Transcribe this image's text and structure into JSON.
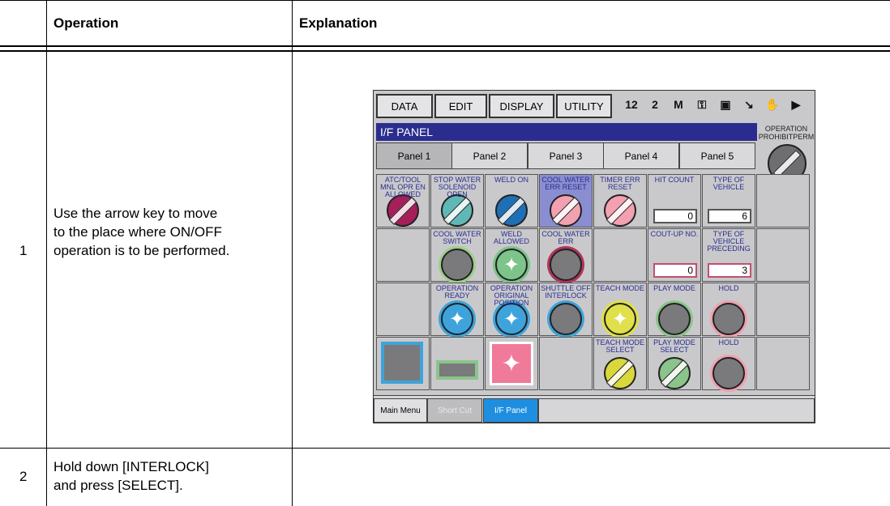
{
  "table": {
    "header_operation": "Operation",
    "header_explanation": "Explanation",
    "rows": [
      {
        "num": "1",
        "operation": "Use the arrow key to move to the place where ON/OFF operation is to be performed."
      },
      {
        "num": "2",
        "operation": "Hold down [INTERLOCK] and press [SELECT]."
      }
    ]
  },
  "screen": {
    "menu": [
      "DATA",
      "EDIT",
      "DISPLAY",
      "UTILITY"
    ],
    "toolbar_icons": [
      "12",
      "2",
      "M",
      "⚿",
      "▣",
      "↘",
      "✋",
      "▶"
    ],
    "toolbar_icon_names": [
      "job-number-icon",
      "step-number-icon",
      "monitor-icon",
      "key-icon",
      "file-icon",
      "arrow-icon",
      "hand-icon",
      "play-icon"
    ],
    "panel_title": "I/F PANEL",
    "corner_knob_label": "OPERATION PROHIBITPERM",
    "tabs": [
      "Panel 1",
      "Panel 2",
      "Panel 3",
      "Panel 4",
      "Panel 5"
    ],
    "selected_tab": 0,
    "grid": [
      [
        {
          "label": "ATC/TOOL MNL OPR EN ALLOWED",
          "type": "knob",
          "color": "#a61e5a"
        },
        {
          "label": "STOP WATER SOLENOID OPEN",
          "type": "knob",
          "color": "#5fb8b6"
        },
        {
          "label": "WELD ON",
          "type": "knob",
          "color": "#1d6fb6"
        },
        {
          "label": "COOL WATER ERR RESET",
          "type": "knob",
          "color": "#f3a0b0",
          "highlight": true
        },
        {
          "label": "TIMER ERR RESET",
          "type": "knob",
          "color": "#f3a0b0"
        },
        {
          "label": "HIT COUNT",
          "type": "counter",
          "value": "0",
          "border": "#555"
        },
        {
          "label": "TYPE OF VEHICLE",
          "type": "counter",
          "value": "6",
          "border": "#555"
        },
        {
          "label": "",
          "type": "empty"
        }
      ],
      [
        {
          "label": "",
          "type": "empty"
        },
        {
          "label": "COOL WATER SWITCH",
          "type": "lamp",
          "color": "#7a7a7c",
          "ring": "#9ccf8a"
        },
        {
          "label": "WELD ALLOWED",
          "type": "lamp-star",
          "color": "#7cc48a",
          "ring": "#7cc48a"
        },
        {
          "label": "COOL WATER ERR",
          "type": "lamp",
          "color": "#7a7a7c",
          "ring": "#b0345a"
        },
        {
          "label": "",
          "type": "empty"
        },
        {
          "label": "COUT-UP NO.",
          "type": "counter",
          "value": "0",
          "border": "#c0506e"
        },
        {
          "label": "TYPE OF VEHICLE PRECEDING",
          "type": "counter",
          "value": "3",
          "border": "#c0506e"
        },
        {
          "label": "",
          "type": "empty"
        }
      ],
      [
        {
          "label": "",
          "type": "empty"
        },
        {
          "label": "OPERATION READY",
          "type": "lamp-star",
          "color": "#3fa3db",
          "ring": "#3fa3db"
        },
        {
          "label": "OPERATION ORIGINAL POSITION",
          "type": "lamp-star",
          "color": "#3fa3db",
          "ring": "#3fa3db"
        },
        {
          "label": "SHUTTLE OFF INTERLOCK",
          "type": "lamp",
          "color": "#7a7a7c",
          "ring": "#3fa3db"
        },
        {
          "label": "TEACH MODE",
          "type": "lamp-star",
          "color": "#e0e04a",
          "ring": "#e0e04a"
        },
        {
          "label": "PLAY MODE",
          "type": "lamp",
          "color": "#7a7a7c",
          "ring": "#8ac48a"
        },
        {
          "label": "HOLD",
          "type": "lamp",
          "color": "#7a7a7c",
          "ring": "#f0a0b0"
        },
        {
          "label": "",
          "type": "empty"
        }
      ],
      [
        {
          "label": "",
          "type": "big-square",
          "color": "#7a7a7c",
          "ring": "#3fa3db"
        },
        {
          "label": "",
          "type": "small-rect",
          "color": "#7a7a7c",
          "ring": "#8ac48a"
        },
        {
          "label": "",
          "type": "pink-square",
          "color": "#f07a9a"
        },
        {
          "label": "",
          "type": "empty"
        },
        {
          "label": "TEACH MODE SELECT",
          "type": "knob",
          "color": "#d8d83a"
        },
        {
          "label": "PLAY MODE SELECT",
          "type": "knob",
          "color": "#8ac48a"
        },
        {
          "label": "HOLD",
          "type": "lamp",
          "color": "#7a7a7c",
          "ring": "#f0a0b0"
        },
        {
          "label": "",
          "type": "empty"
        }
      ]
    ],
    "bottom": {
      "main_menu": "Main Menu",
      "short_cut": "Short Cut",
      "if_panel": "I/F Panel"
    }
  }
}
